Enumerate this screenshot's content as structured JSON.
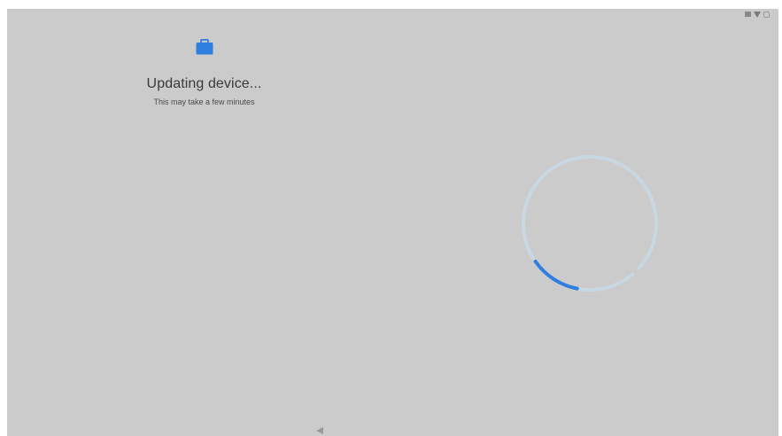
{
  "setup": {
    "title": "Updating device...",
    "subtitle": "This may take a few minutes",
    "icon": "briefcase-icon"
  },
  "status_bar": {
    "icons": [
      "battery-icon",
      "wifi-icon",
      "notification-icon"
    ]
  },
  "navigation": {
    "back_icon": "back-triangle-icon"
  },
  "colors": {
    "screen_background": "#cbcbcb",
    "accent": "#2f7fe0",
    "spinner_track": "#c7d9e6",
    "text_primary": "#3a3a3a",
    "text_secondary": "#4a4a4a"
  }
}
